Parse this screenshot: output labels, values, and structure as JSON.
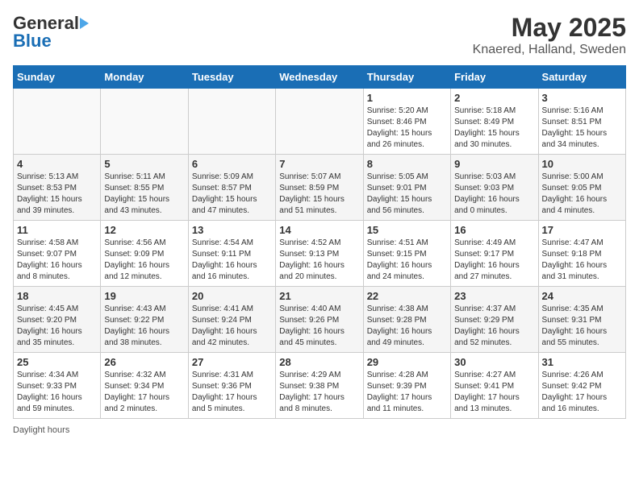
{
  "header": {
    "logo_general": "General",
    "logo_blue": "Blue",
    "title": "May 2025",
    "subtitle": "Knaered, Halland, Sweden"
  },
  "days_of_week": [
    "Sunday",
    "Monday",
    "Tuesday",
    "Wednesday",
    "Thursday",
    "Friday",
    "Saturday"
  ],
  "footer": {
    "daylight_hours": "Daylight hours"
  },
  "weeks": [
    [
      {
        "num": "",
        "info": ""
      },
      {
        "num": "",
        "info": ""
      },
      {
        "num": "",
        "info": ""
      },
      {
        "num": "",
        "info": ""
      },
      {
        "num": "1",
        "info": "Sunrise: 5:20 AM\nSunset: 8:46 PM\nDaylight: 15 hours\nand 26 minutes."
      },
      {
        "num": "2",
        "info": "Sunrise: 5:18 AM\nSunset: 8:49 PM\nDaylight: 15 hours\nand 30 minutes."
      },
      {
        "num": "3",
        "info": "Sunrise: 5:16 AM\nSunset: 8:51 PM\nDaylight: 15 hours\nand 34 minutes."
      }
    ],
    [
      {
        "num": "4",
        "info": "Sunrise: 5:13 AM\nSunset: 8:53 PM\nDaylight: 15 hours\nand 39 minutes."
      },
      {
        "num": "5",
        "info": "Sunrise: 5:11 AM\nSunset: 8:55 PM\nDaylight: 15 hours\nand 43 minutes."
      },
      {
        "num": "6",
        "info": "Sunrise: 5:09 AM\nSunset: 8:57 PM\nDaylight: 15 hours\nand 47 minutes."
      },
      {
        "num": "7",
        "info": "Sunrise: 5:07 AM\nSunset: 8:59 PM\nDaylight: 15 hours\nand 51 minutes."
      },
      {
        "num": "8",
        "info": "Sunrise: 5:05 AM\nSunset: 9:01 PM\nDaylight: 15 hours\nand 56 minutes."
      },
      {
        "num": "9",
        "info": "Sunrise: 5:03 AM\nSunset: 9:03 PM\nDaylight: 16 hours\nand 0 minutes."
      },
      {
        "num": "10",
        "info": "Sunrise: 5:00 AM\nSunset: 9:05 PM\nDaylight: 16 hours\nand 4 minutes."
      }
    ],
    [
      {
        "num": "11",
        "info": "Sunrise: 4:58 AM\nSunset: 9:07 PM\nDaylight: 16 hours\nand 8 minutes."
      },
      {
        "num": "12",
        "info": "Sunrise: 4:56 AM\nSunset: 9:09 PM\nDaylight: 16 hours\nand 12 minutes."
      },
      {
        "num": "13",
        "info": "Sunrise: 4:54 AM\nSunset: 9:11 PM\nDaylight: 16 hours\nand 16 minutes."
      },
      {
        "num": "14",
        "info": "Sunrise: 4:52 AM\nSunset: 9:13 PM\nDaylight: 16 hours\nand 20 minutes."
      },
      {
        "num": "15",
        "info": "Sunrise: 4:51 AM\nSunset: 9:15 PM\nDaylight: 16 hours\nand 24 minutes."
      },
      {
        "num": "16",
        "info": "Sunrise: 4:49 AM\nSunset: 9:17 PM\nDaylight: 16 hours\nand 27 minutes."
      },
      {
        "num": "17",
        "info": "Sunrise: 4:47 AM\nSunset: 9:18 PM\nDaylight: 16 hours\nand 31 minutes."
      }
    ],
    [
      {
        "num": "18",
        "info": "Sunrise: 4:45 AM\nSunset: 9:20 PM\nDaylight: 16 hours\nand 35 minutes."
      },
      {
        "num": "19",
        "info": "Sunrise: 4:43 AM\nSunset: 9:22 PM\nDaylight: 16 hours\nand 38 minutes."
      },
      {
        "num": "20",
        "info": "Sunrise: 4:41 AM\nSunset: 9:24 PM\nDaylight: 16 hours\nand 42 minutes."
      },
      {
        "num": "21",
        "info": "Sunrise: 4:40 AM\nSunset: 9:26 PM\nDaylight: 16 hours\nand 45 minutes."
      },
      {
        "num": "22",
        "info": "Sunrise: 4:38 AM\nSunset: 9:28 PM\nDaylight: 16 hours\nand 49 minutes."
      },
      {
        "num": "23",
        "info": "Sunrise: 4:37 AM\nSunset: 9:29 PM\nDaylight: 16 hours\nand 52 minutes."
      },
      {
        "num": "24",
        "info": "Sunrise: 4:35 AM\nSunset: 9:31 PM\nDaylight: 16 hours\nand 55 minutes."
      }
    ],
    [
      {
        "num": "25",
        "info": "Sunrise: 4:34 AM\nSunset: 9:33 PM\nDaylight: 16 hours\nand 59 minutes."
      },
      {
        "num": "26",
        "info": "Sunrise: 4:32 AM\nSunset: 9:34 PM\nDaylight: 17 hours\nand 2 minutes."
      },
      {
        "num": "27",
        "info": "Sunrise: 4:31 AM\nSunset: 9:36 PM\nDaylight: 17 hours\nand 5 minutes."
      },
      {
        "num": "28",
        "info": "Sunrise: 4:29 AM\nSunset: 9:38 PM\nDaylight: 17 hours\nand 8 minutes."
      },
      {
        "num": "29",
        "info": "Sunrise: 4:28 AM\nSunset: 9:39 PM\nDaylight: 17 hours\nand 11 minutes."
      },
      {
        "num": "30",
        "info": "Sunrise: 4:27 AM\nSunset: 9:41 PM\nDaylight: 17 hours\nand 13 minutes."
      },
      {
        "num": "31",
        "info": "Sunrise: 4:26 AM\nSunset: 9:42 PM\nDaylight: 17 hours\nand 16 minutes."
      }
    ]
  ]
}
